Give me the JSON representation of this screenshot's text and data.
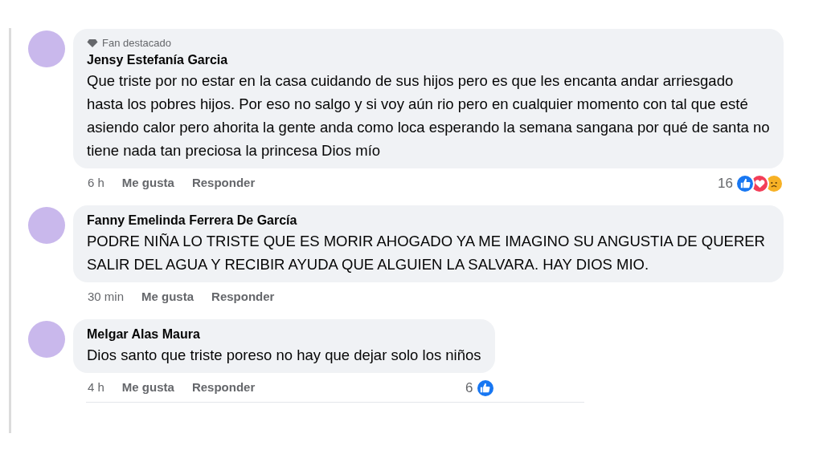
{
  "comments": [
    {
      "badge": "Fan destacado",
      "author": "Jensy Estefanía Garcia",
      "text": "Que triste por no estar en la casa cuidando de sus hijos pero es que les encanta andar arriesgado hasta los pobres hijos. Por eso no salgo y si voy aún rio pero en cualquier momento con tal que esté asiendo calor pero ahorita la gente anda como loca esperando la semana sangana por qué de santa no tiene nada tan preciosa la princesa Dios mío",
      "time": "6 h",
      "like": "Me gusta",
      "reply": "Responder",
      "reaction_count": "16",
      "reactions": [
        {
          "kind": "like"
        },
        {
          "kind": "love"
        },
        {
          "kind": "sad"
        }
      ]
    },
    {
      "author": "Fanny Emelinda Ferrera De García",
      "text": "PODRE NIÑA LO TRISTE QUE ES MORIR AHOGADO YA ME IMAGINO SU ANGUSTIA DE QUERER SALIR DEL AGUA Y RECIBIR AYUDA QUE ALGUIEN LA SALVARA. HAY DIOS MIO.",
      "time": "30 min",
      "like": "Me gusta",
      "reply": "Responder"
    },
    {
      "author": "Melgar Alas Maura",
      "text": "Dios santo que triste poreso no hay que dejar solo los niños",
      "time": "4 h",
      "like": "Me gusta",
      "reply": "Responder",
      "reaction_count": "6",
      "reactions": [
        {
          "kind": "like"
        }
      ]
    }
  ]
}
